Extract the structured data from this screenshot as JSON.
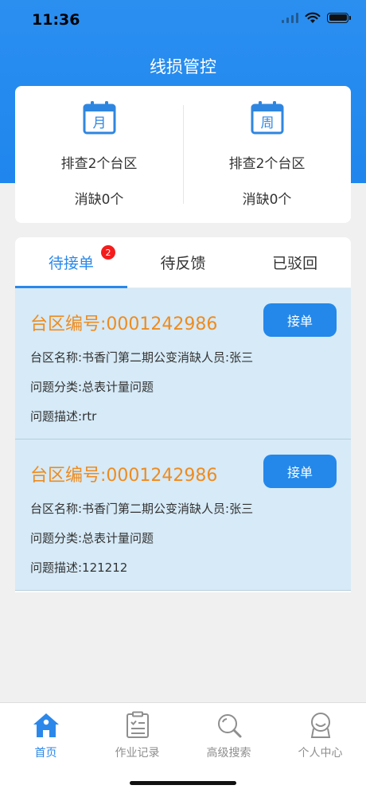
{
  "status_bar": {
    "time": "11:36"
  },
  "header": {
    "title": "线损管控"
  },
  "summary": [
    {
      "icon": "calendar-month-icon",
      "icon_char": "月",
      "line1": "排查2个台区",
      "line2": "消缺0个"
    },
    {
      "icon": "calendar-week-icon",
      "icon_char": "周",
      "line1": "排查2个台区",
      "line2": "消缺0个"
    }
  ],
  "tabs": [
    {
      "label": "待接单",
      "badge": "2",
      "active": true
    },
    {
      "label": "待反馈"
    },
    {
      "label": "已驳回"
    }
  ],
  "orders": [
    {
      "code": "台区编号:0001242986",
      "button": "接单",
      "line1": "台区名称:书香门第二期公变消缺人员:张三",
      "line2": "问题分类:总表计量问题",
      "line3": "问题描述:rtr"
    },
    {
      "code": "台区编号:0001242986",
      "button": "接单",
      "line1": "台区名称:书香门第二期公变消缺人员:张三",
      "line2": "问题分类:总表计量问题",
      "line3": "问题描述:121212"
    }
  ],
  "tabbar": [
    {
      "label": "首页",
      "icon": "home-icon",
      "active": true
    },
    {
      "label": "作业记录",
      "icon": "clipboard-list-icon"
    },
    {
      "label": "高级搜索",
      "icon": "search-icon"
    },
    {
      "label": "个人中心",
      "icon": "user-icon"
    }
  ],
  "colors": {
    "primary": "#2388ea",
    "accent_orange": "#ef8b1e",
    "badge_red": "#f51c1c",
    "order_bg": "#d6eaf7"
  }
}
